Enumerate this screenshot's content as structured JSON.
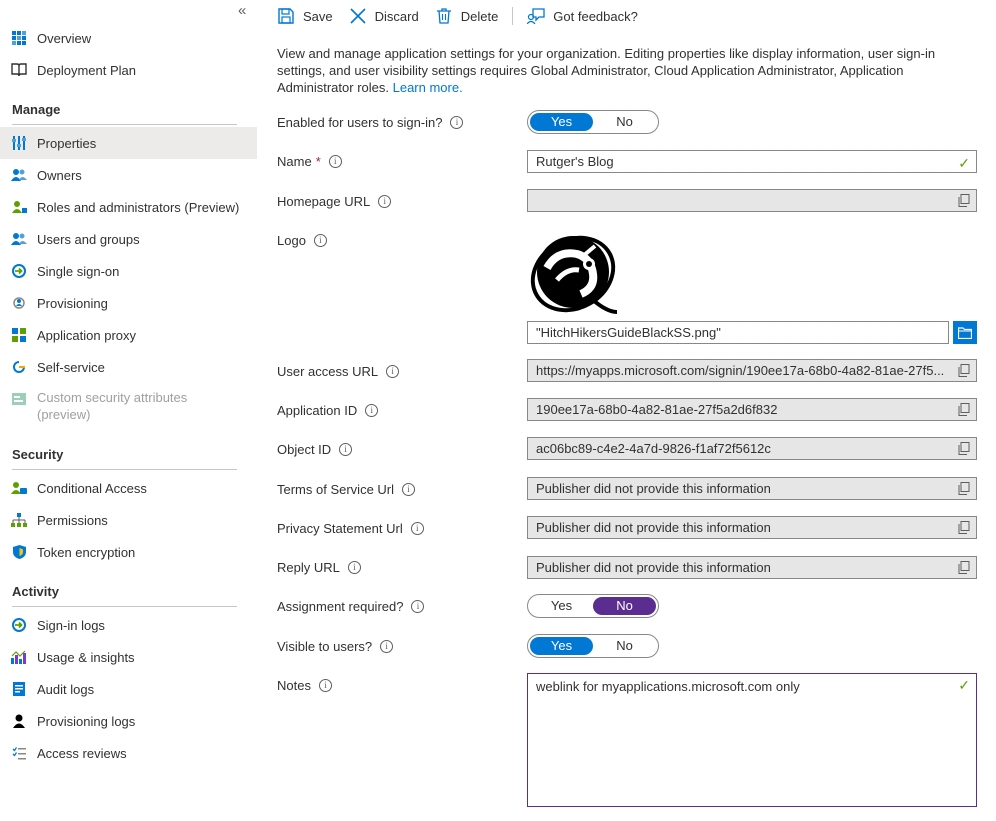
{
  "sidebar": {
    "collapse_icon": "«",
    "top_items": [
      {
        "label": "Overview",
        "icon": "grid-icon"
      },
      {
        "label": "Deployment Plan",
        "icon": "book-icon"
      }
    ],
    "sections": [
      {
        "title": "Manage",
        "items": [
          {
            "label": "Properties",
            "icon": "properties-icon",
            "active": true
          },
          {
            "label": "Owners",
            "icon": "owners-icon"
          },
          {
            "label": "Roles and administrators (Preview)",
            "icon": "roles-icon"
          },
          {
            "label": "Users and groups",
            "icon": "users-groups-icon"
          },
          {
            "label": "Single sign-on",
            "icon": "sso-icon"
          },
          {
            "label": "Provisioning",
            "icon": "provisioning-icon"
          },
          {
            "label": "Application proxy",
            "icon": "app-proxy-icon"
          },
          {
            "label": "Self-service",
            "icon": "self-service-icon"
          },
          {
            "label": "Custom security attributes (preview)",
            "icon": "custom-attributes-icon",
            "disabled": true
          }
        ]
      },
      {
        "title": "Security",
        "items": [
          {
            "label": "Conditional Access",
            "icon": "conditional-access-icon"
          },
          {
            "label": "Permissions",
            "icon": "permissions-icon"
          },
          {
            "label": "Token encryption",
            "icon": "shield-icon"
          }
        ]
      },
      {
        "title": "Activity",
        "items": [
          {
            "label": "Sign-in logs",
            "icon": "signin-logs-icon"
          },
          {
            "label": "Usage & insights",
            "icon": "usage-icon"
          },
          {
            "label": "Audit logs",
            "icon": "audit-logs-icon"
          },
          {
            "label": "Provisioning logs",
            "icon": "provisioning-logs-icon"
          },
          {
            "label": "Access reviews",
            "icon": "access-reviews-icon"
          }
        ]
      }
    ]
  },
  "toolbar": {
    "save_label": "Save",
    "discard_label": "Discard",
    "delete_label": "Delete",
    "feedback_label": "Got feedback?"
  },
  "description": {
    "text": "View and manage application settings for your organization. Editing properties like display information, user sign-in settings, and user visibility settings requires Global Administrator, Cloud Application Administrator, Application Administrator roles.",
    "link": "Learn more."
  },
  "form": {
    "enabled": {
      "label": "Enabled for users to sign-in?",
      "yes": "Yes",
      "no": "No",
      "value": "Yes"
    },
    "name": {
      "label": "Name",
      "required": "*",
      "value": "Rutger's Blog"
    },
    "homepage": {
      "label": "Homepage URL",
      "value": ""
    },
    "logo": {
      "label": "Logo",
      "file": "\"HitchHikersGuideBlackSS.png\""
    },
    "user_access_url": {
      "label": "User access URL",
      "value": "https://myapps.microsoft.com/signin/190ee17a-68b0-4a82-81ae-27f5..."
    },
    "application_id": {
      "label": "Application ID",
      "value": "190ee17a-68b0-4a82-81ae-27f5a2d6f832"
    },
    "object_id": {
      "label": "Object ID",
      "value": "ac06bc89-c4e2-4a7d-9826-f1af72f5612c"
    },
    "terms_url": {
      "label": "Terms of Service Url",
      "value": "Publisher did not provide this information"
    },
    "privacy_url": {
      "label": "Privacy Statement Url",
      "value": "Publisher did not provide this information"
    },
    "reply_url": {
      "label": "Reply URL",
      "value": "Publisher did not provide this information"
    },
    "assignment": {
      "label": "Assignment required?",
      "yes": "Yes",
      "no": "No",
      "value": "No"
    },
    "visible": {
      "label": "Visible to users?",
      "yes": "Yes",
      "no": "No",
      "value": "Yes"
    },
    "notes": {
      "label": "Notes",
      "value": "weblink for myapplications.microsoft.com only"
    }
  },
  "colors": {
    "accent": "#0078d4",
    "purple": "#5c2d91",
    "valid": "#57a300"
  }
}
